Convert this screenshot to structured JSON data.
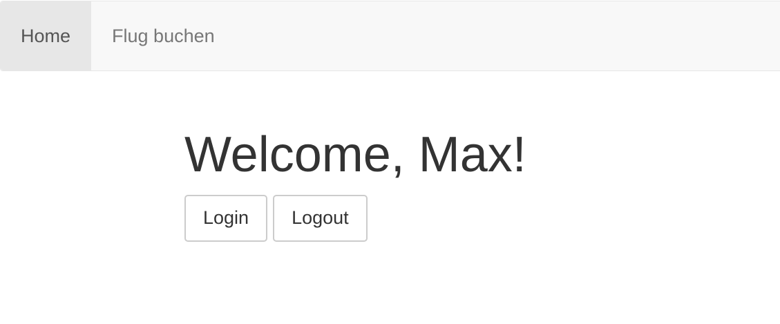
{
  "nav": {
    "items": [
      {
        "label": "Home",
        "active": true
      },
      {
        "label": "Flug buchen",
        "active": false
      }
    ]
  },
  "main": {
    "welcome_text": "Welcome, Max!",
    "login_label": "Login",
    "logout_label": "Logout"
  },
  "colors": {
    "navbar_bg": "#f8f8f8",
    "navbar_active_bg": "#e7e7e7",
    "text": "#333333",
    "nav_text": "#777777",
    "button_border": "#cccccc"
  }
}
